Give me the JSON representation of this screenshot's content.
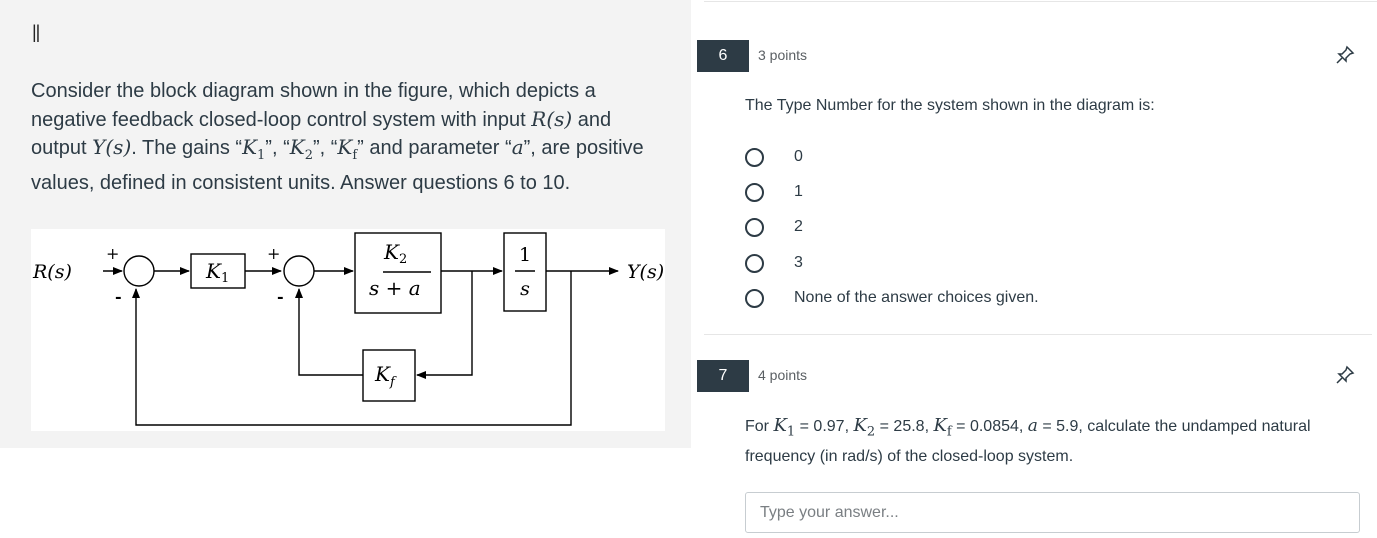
{
  "left": {
    "handle": "||",
    "description": {
      "t1": "Consider the block diagram shown in the figure, which depicts a negative feedback closed-loop control system with input ",
      "m_input": "R(s)",
      "t2": " and output ",
      "m_output": "Y(s)",
      "t3": ". The gains “",
      "m_k1": "K",
      "m_k1_sub": "1",
      "t4": "”, “",
      "m_k2": "K",
      "m_k2_sub": "2",
      "t5": "”, “",
      "m_kf": "K",
      "m_kf_sub": "f",
      "t6": "” and parameter “",
      "m_a": "a",
      "t7": "”, are positive values, defined in consistent units. Answer questions 6 to 10."
    },
    "diagram": {
      "input_label": "R(s)",
      "output_label": "Y(s)",
      "plus": "+",
      "minus": "-",
      "k1": "K",
      "k1_sub": "1",
      "k2": "K",
      "k2_sub": "2",
      "tf_den": "s + a",
      "integ_num": "1",
      "integ_den": "s",
      "kf": "K",
      "kf_sub": "f"
    }
  },
  "q6": {
    "number": "6",
    "points": "3 points",
    "prompt": "The Type Number for the system shown in the diagram is:",
    "choices": [
      "0",
      "1",
      "2",
      "3",
      "None of the answer choices given."
    ]
  },
  "q7": {
    "number": "7",
    "points": "4 points",
    "p_for": "For ",
    "k1_sym": "K",
    "k1_sub": "1",
    "k1_val": " = 0.97, ",
    "k2_sym": "K",
    "k2_sub": "2",
    "k2_val": " = 25.8, ",
    "kf_sym": "K",
    "kf_sub": "f",
    "kf_val": " = 0.0854, ",
    "a_sym": "a",
    "a_val": " = 5.9, calculate the undamped natural frequency (in rad/s) of the closed-loop system.",
    "input_placeholder": "Type your answer..."
  },
  "colors": {
    "badge": "#2d3b45",
    "panel": "#f3f3f3",
    "text": "#2d3b45"
  },
  "icons": {
    "pin": "pin-icon",
    "handle": "drag-handle-icon"
  }
}
